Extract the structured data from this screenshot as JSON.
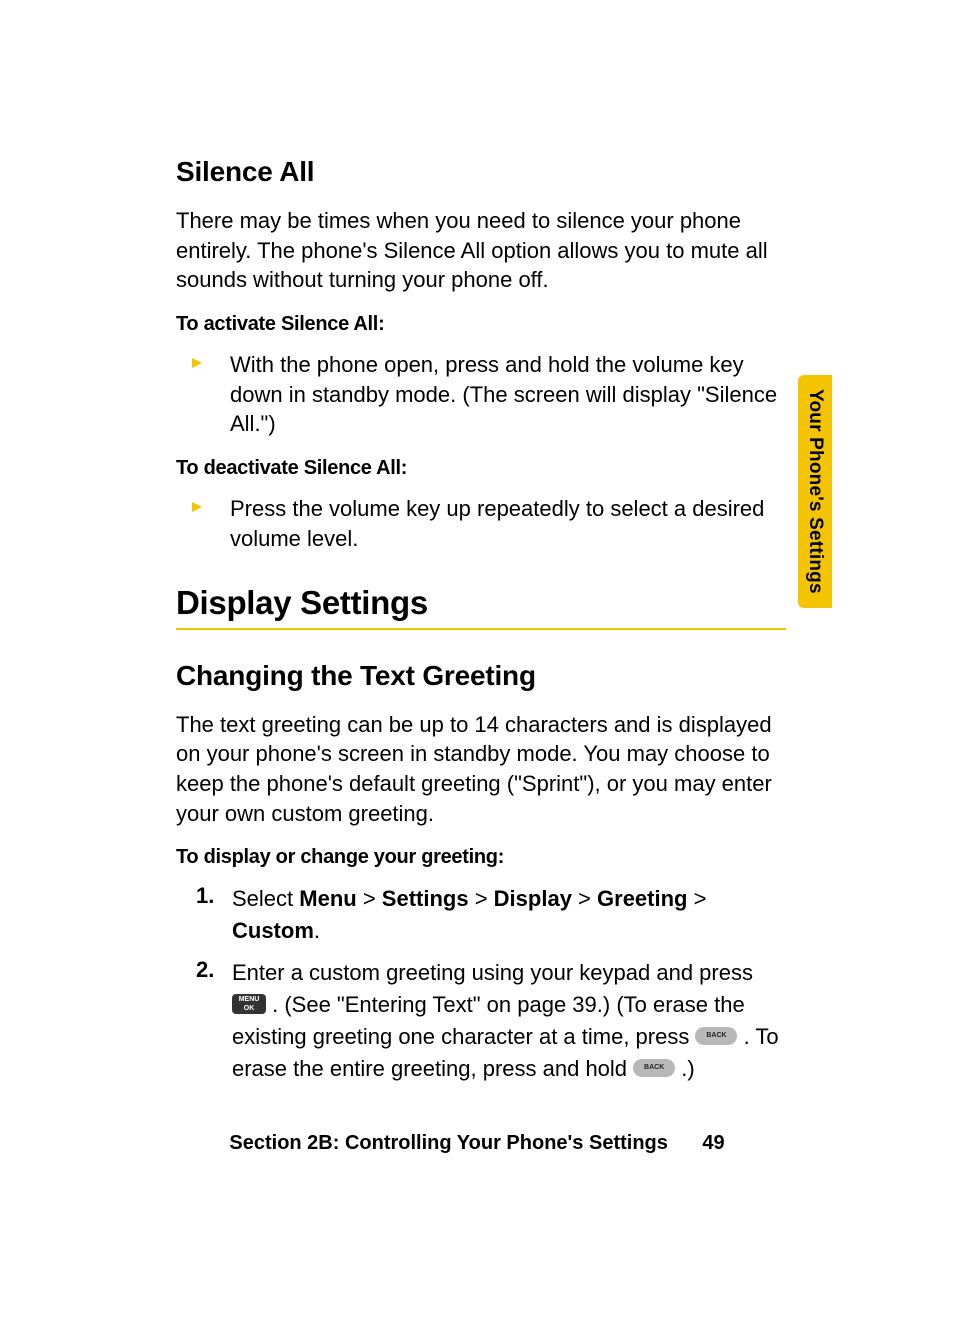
{
  "side_tab": "Your Phone's Settings",
  "silence": {
    "heading": "Silence All",
    "intro": "There may be times when you need to silence your phone entirely. The phone's Silence All option allows you to mute all sounds without turning your phone off.",
    "activate_label": "To activate Silence All:",
    "activate_step": "With the phone open, press and hold the volume key down in standby mode. (The screen will display \"Silence All.\")",
    "deactivate_label": "To deactivate Silence All:",
    "deactivate_step": "Press the volume key up repeatedly to select a desired volume level."
  },
  "display": {
    "section_heading": "Display Settings",
    "greeting_heading": "Changing the Text Greeting",
    "greeting_intro": "The text greeting can be up to 14 characters and is displayed on your phone's screen in standby mode. You may choose to keep the phone's default greeting (\"Sprint\"), or you may enter your own custom greeting.",
    "greeting_label": "To display or change your greeting:",
    "step1_num": "1.",
    "step1_pre": "Select ",
    "step1_b1": "Menu",
    "step1_sep": " > ",
    "step1_b2": "Settings",
    "step1_b3": "Display",
    "step1_b4": "Greeting",
    "step1_b5": "Custom",
    "step1_end": ".",
    "step2_num": "2.",
    "step2_a": "Enter a custom greeting using your keypad and press ",
    "step2_b": ". (See \"Entering Text\" on page 39.) (To erase the existing greeting one character at a time, press ",
    "step2_c": ". To erase the entire greeting, press and hold ",
    "step2_d": ".)"
  },
  "footer": {
    "text": "Section 2B: Controlling Your Phone's Settings",
    "page": "49"
  }
}
